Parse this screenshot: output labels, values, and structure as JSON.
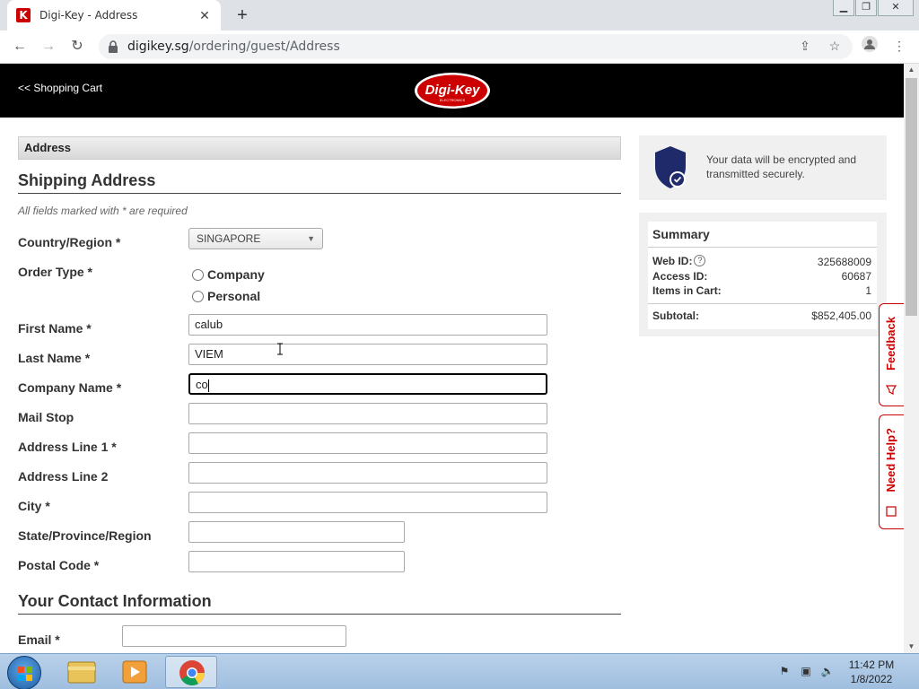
{
  "browser": {
    "tab_title": "Digi-Key - Address",
    "favicon_letter": "K",
    "url_host": "digikey.sg",
    "url_path": "/ordering/guest/Address"
  },
  "header": {
    "back_link": "<< Shopping Cart",
    "logo_text": "Digi-Key",
    "logo_subtext": "ELECTRONICS"
  },
  "form": {
    "section_title": "Address",
    "shipping_heading": "Shipping Address",
    "required_note": "All fields marked with * are required",
    "country": {
      "label": "Country/Region *",
      "value": "SINGAPORE"
    },
    "order_type": {
      "label": "Order Type *",
      "options": [
        "Company",
        "Personal"
      ]
    },
    "first_name": {
      "label": "First Name *",
      "value": "calub"
    },
    "last_name": {
      "label": "Last Name *",
      "value": "VIEM"
    },
    "company_name": {
      "label": "Company Name *",
      "value": "co"
    },
    "mail_stop": {
      "label": "Mail Stop",
      "value": ""
    },
    "address1": {
      "label": "Address Line 1 *",
      "value": ""
    },
    "address2": {
      "label": "Address Line 2",
      "value": ""
    },
    "city": {
      "label": "City *",
      "value": ""
    },
    "state": {
      "label": "State/Province/Region",
      "value": ""
    },
    "postal": {
      "label": "Postal Code *",
      "value": ""
    },
    "contact_heading": "Your Contact Information",
    "email": {
      "label": "Email *",
      "value": ""
    }
  },
  "secure": {
    "text": "Your data will be encrypted and transmitted securely."
  },
  "summary": {
    "title": "Summary",
    "web_id_label": "Web ID:",
    "web_id": "325688009",
    "access_id_label": "Access ID:",
    "access_id": "60687",
    "items_label": "Items in Cart:",
    "items": "1",
    "subtotal_label": "Subtotal:",
    "subtotal": "$852,405.00"
  },
  "side_tabs": {
    "feedback": "Feedback",
    "help": "Need Help?"
  },
  "taskbar": {
    "time": "11:42 PM",
    "date": "1/8/2022"
  },
  "colors": {
    "brand_red": "#cc0000",
    "header_bg": "#000000",
    "shield_blue": "#1f2a6b"
  }
}
